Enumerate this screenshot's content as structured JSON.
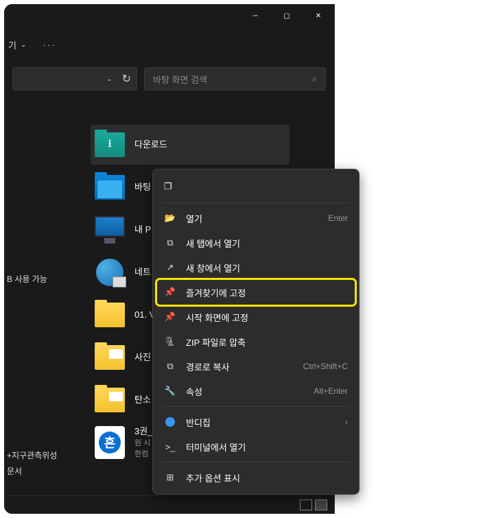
{
  "window": {
    "minimize": "─",
    "maximize": "▢",
    "close": "✕"
  },
  "toolbar": {
    "view_label": "기",
    "more": "···"
  },
  "address": {
    "chevron": "⌄",
    "refresh": "↻"
  },
  "search": {
    "placeholder": "바탕 화면 검색",
    "icon": "⌕"
  },
  "sidebar": {
    "avail": "B 사용 가능",
    "sat": "+지구관측위성",
    "doc": "문서"
  },
  "grid": [
    {
      "label": "다운로드",
      "type": "downloads"
    },
    {
      "label": "바팅",
      "type": "desktop"
    },
    {
      "label": "내 P",
      "type": "pc"
    },
    {
      "label": "네트",
      "type": "network"
    },
    {
      "label": "01. V",
      "type": "folder"
    },
    {
      "label": "사진",
      "type": "folder-img"
    },
    {
      "label": "탄소",
      "type": "folder-img"
    },
    {
      "label": "3권_",
      "sub1": "원 시",
      "sub2": "한컴",
      "type": "hwp"
    }
  ],
  "ctx": {
    "copy_icon": "❐",
    "items": [
      {
        "icon": "📂",
        "label": "열기",
        "short": "Enter"
      },
      {
        "icon": "⧉",
        "label": "새 탭에서 열기",
        "short": ""
      },
      {
        "icon": "↗",
        "label": "새 창에서 열기",
        "short": ""
      },
      {
        "icon": "📌",
        "label": "즐겨찾기에 고정",
        "short": "",
        "hi": true
      },
      {
        "icon": "📌",
        "label": "시작 화면에 고정",
        "short": ""
      },
      {
        "icon": "🗜",
        "label": "ZIP 파일로 압축",
        "short": ""
      },
      {
        "icon": "⧉",
        "label": "경로로 복사",
        "short": "Ctrl+Shift+C"
      },
      {
        "icon": "🔧",
        "label": "속성",
        "short": "Alt+Enter"
      }
    ],
    "extra": [
      {
        "icon": "blob",
        "label": "반디집",
        "arrow": "›"
      },
      {
        "icon": "⌘",
        "label": "터미널에서 열기",
        "arrow": ""
      }
    ],
    "more": {
      "icon": "⊞",
      "label": "추가 옵션 표시"
    }
  },
  "status": {}
}
